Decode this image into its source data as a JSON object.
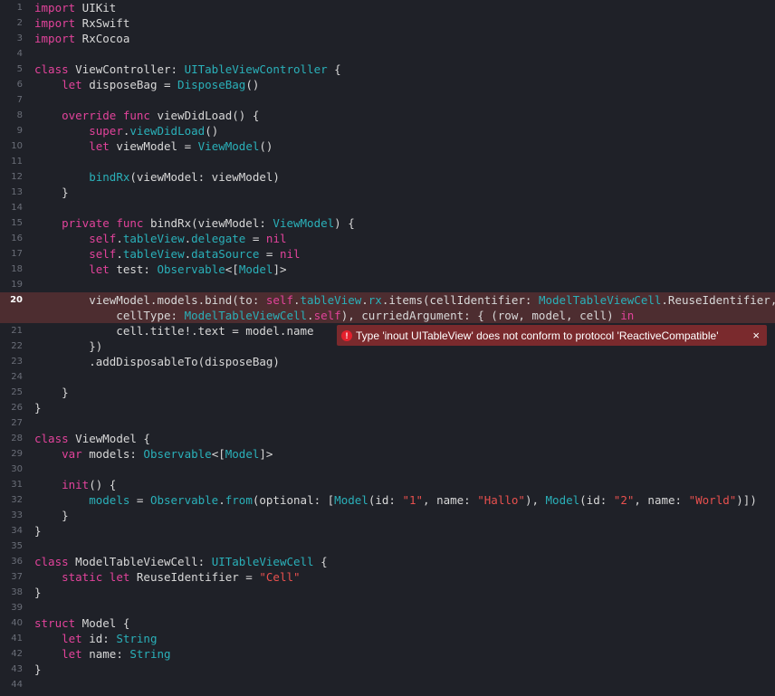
{
  "editor": {
    "colors": {
      "background": "#1f2128",
      "keyword": "#e2439b",
      "type": "#2ab0b9",
      "string": "#e8504e",
      "plain": "#d8d8d8",
      "error_line": "#4d2d30",
      "error_popup": "#7a2a2d"
    },
    "error": {
      "icon": "error-icon",
      "message": "Type 'inout UITableView' does not conform to protocol 'ReactiveCompatible'",
      "close": "×"
    },
    "lines": [
      {
        "n": "1",
        "segs": [
          [
            "kw",
            "import"
          ],
          [
            "plain",
            " UIKit"
          ]
        ]
      },
      {
        "n": "2",
        "segs": [
          [
            "kw",
            "import"
          ],
          [
            "plain",
            " RxSwift"
          ]
        ]
      },
      {
        "n": "3",
        "segs": [
          [
            "kw",
            "import"
          ],
          [
            "plain",
            " RxCocoa"
          ]
        ]
      },
      {
        "n": "4",
        "segs": []
      },
      {
        "n": "5",
        "segs": [
          [
            "kw",
            "class"
          ],
          [
            "plain",
            " ViewController: "
          ],
          [
            "type",
            "UITableViewController"
          ],
          [
            "plain",
            " {"
          ]
        ]
      },
      {
        "n": "6",
        "segs": [
          [
            "plain",
            "    "
          ],
          [
            "kw",
            "let"
          ],
          [
            "plain",
            " disposeBag = "
          ],
          [
            "type",
            "DisposeBag"
          ],
          [
            "plain",
            "()"
          ]
        ]
      },
      {
        "n": "7",
        "segs": []
      },
      {
        "n": "8",
        "segs": [
          [
            "plain",
            "    "
          ],
          [
            "kw",
            "override func"
          ],
          [
            "plain",
            " viewDidLoad() {"
          ]
        ]
      },
      {
        "n": "9",
        "segs": [
          [
            "plain",
            "        "
          ],
          [
            "kw",
            "super"
          ],
          [
            "plain",
            "."
          ],
          [
            "type",
            "viewDidLoad"
          ],
          [
            "plain",
            "()"
          ]
        ]
      },
      {
        "n": "10",
        "segs": [
          [
            "plain",
            "        "
          ],
          [
            "kw",
            "let"
          ],
          [
            "plain",
            " viewModel = "
          ],
          [
            "type",
            "ViewModel"
          ],
          [
            "plain",
            "()"
          ]
        ]
      },
      {
        "n": "11",
        "segs": []
      },
      {
        "n": "12",
        "segs": [
          [
            "plain",
            "        "
          ],
          [
            "type",
            "bindRx"
          ],
          [
            "plain",
            "(viewModel: viewModel)"
          ]
        ]
      },
      {
        "n": "13",
        "segs": [
          [
            "plain",
            "    }"
          ]
        ]
      },
      {
        "n": "14",
        "segs": []
      },
      {
        "n": "15",
        "segs": [
          [
            "plain",
            "    "
          ],
          [
            "kw",
            "private func"
          ],
          [
            "plain",
            " bindRx(viewModel: "
          ],
          [
            "type",
            "ViewModel"
          ],
          [
            "plain",
            ") {"
          ]
        ]
      },
      {
        "n": "16",
        "segs": [
          [
            "plain",
            "        "
          ],
          [
            "kw",
            "self"
          ],
          [
            "plain",
            "."
          ],
          [
            "type",
            "tableView"
          ],
          [
            "plain",
            "."
          ],
          [
            "type",
            "delegate"
          ],
          [
            "plain",
            " = "
          ],
          [
            "kw",
            "nil"
          ]
        ]
      },
      {
        "n": "17",
        "segs": [
          [
            "plain",
            "        "
          ],
          [
            "kw",
            "self"
          ],
          [
            "plain",
            "."
          ],
          [
            "type",
            "tableView"
          ],
          [
            "plain",
            "."
          ],
          [
            "type",
            "dataSource"
          ],
          [
            "plain",
            " = "
          ],
          [
            "kw",
            "nil"
          ]
        ]
      },
      {
        "n": "18",
        "segs": [
          [
            "plain",
            "        "
          ],
          [
            "kw",
            "let"
          ],
          [
            "plain",
            " test: "
          ],
          [
            "type",
            "Observable"
          ],
          [
            "plain",
            "<["
          ],
          [
            "type",
            "Model"
          ],
          [
            "plain",
            "]>"
          ]
        ]
      },
      {
        "n": "19",
        "segs": []
      },
      {
        "n": "20",
        "error": true,
        "segs": [
          [
            "plain",
            "        viewModel.models.bind(to: "
          ],
          [
            "kw",
            "self"
          ],
          [
            "plain",
            "."
          ],
          [
            "type",
            "tableView"
          ],
          [
            "plain",
            "."
          ],
          [
            "type",
            "rx"
          ],
          [
            "plain",
            ".items(cellIdentifier: "
          ],
          [
            "type",
            "ModelTableViewCell"
          ],
          [
            "plain",
            ".ReuseIdentifier,\n            cellType: "
          ],
          [
            "type",
            "ModelTableViewCell"
          ],
          [
            "plain",
            "."
          ],
          [
            "kw",
            "self"
          ],
          [
            "plain",
            "), curriedArgument: { (row, model, cell) "
          ],
          [
            "kw",
            "in"
          ]
        ]
      },
      {
        "n": "21",
        "segs": [
          [
            "plain",
            "            cell.title!.text = model.name"
          ]
        ]
      },
      {
        "n": "22",
        "segs": [
          [
            "plain",
            "        })"
          ]
        ]
      },
      {
        "n": "23",
        "segs": [
          [
            "plain",
            "        .addDisposableTo(disposeBag)"
          ]
        ]
      },
      {
        "n": "24",
        "segs": []
      },
      {
        "n": "25",
        "segs": [
          [
            "plain",
            "    }"
          ]
        ]
      },
      {
        "n": "26",
        "segs": [
          [
            "plain",
            "}"
          ]
        ]
      },
      {
        "n": "27",
        "segs": []
      },
      {
        "n": "28",
        "segs": [
          [
            "kw",
            "class"
          ],
          [
            "plain",
            " ViewModel {"
          ]
        ]
      },
      {
        "n": "29",
        "segs": [
          [
            "plain",
            "    "
          ],
          [
            "kw",
            "var"
          ],
          [
            "plain",
            " models: "
          ],
          [
            "type",
            "Observable"
          ],
          [
            "plain",
            "<["
          ],
          [
            "type",
            "Model"
          ],
          [
            "plain",
            "]>"
          ]
        ]
      },
      {
        "n": "30",
        "segs": []
      },
      {
        "n": "31",
        "segs": [
          [
            "plain",
            "    "
          ],
          [
            "kw",
            "init"
          ],
          [
            "plain",
            "() {"
          ]
        ]
      },
      {
        "n": "32",
        "segs": [
          [
            "plain",
            "        "
          ],
          [
            "type",
            "models"
          ],
          [
            "plain",
            " = "
          ],
          [
            "type",
            "Observable"
          ],
          [
            "plain",
            "."
          ],
          [
            "type",
            "from"
          ],
          [
            "plain",
            "(optional: ["
          ],
          [
            "type",
            "Model"
          ],
          [
            "plain",
            "(id: "
          ],
          [
            "str",
            "\"1\""
          ],
          [
            "plain",
            ", name: "
          ],
          [
            "str",
            "\"Hallo\""
          ],
          [
            "plain",
            "), "
          ],
          [
            "type",
            "Model"
          ],
          [
            "plain",
            "(id: "
          ],
          [
            "str",
            "\"2\""
          ],
          [
            "plain",
            ", name: "
          ],
          [
            "str",
            "\"World\""
          ],
          [
            "plain",
            ")])"
          ]
        ]
      },
      {
        "n": "33",
        "segs": [
          [
            "plain",
            "    }"
          ]
        ]
      },
      {
        "n": "34",
        "segs": [
          [
            "plain",
            "}"
          ]
        ]
      },
      {
        "n": "35",
        "segs": []
      },
      {
        "n": "36",
        "segs": [
          [
            "kw",
            "class"
          ],
          [
            "plain",
            " ModelTableViewCell: "
          ],
          [
            "type",
            "UITableViewCell"
          ],
          [
            "plain",
            " {"
          ]
        ]
      },
      {
        "n": "37",
        "segs": [
          [
            "plain",
            "    "
          ],
          [
            "kw",
            "static let"
          ],
          [
            "plain",
            " ReuseIdentifier = "
          ],
          [
            "str",
            "\"Cell\""
          ]
        ]
      },
      {
        "n": "38",
        "segs": [
          [
            "plain",
            "}"
          ]
        ]
      },
      {
        "n": "39",
        "segs": []
      },
      {
        "n": "40",
        "segs": [
          [
            "kw",
            "struct"
          ],
          [
            "plain",
            " Model {"
          ]
        ]
      },
      {
        "n": "41",
        "segs": [
          [
            "plain",
            "    "
          ],
          [
            "kw",
            "let"
          ],
          [
            "plain",
            " id: "
          ],
          [
            "type",
            "String"
          ]
        ]
      },
      {
        "n": "42",
        "segs": [
          [
            "plain",
            "    "
          ],
          [
            "kw",
            "let"
          ],
          [
            "plain",
            " name: "
          ],
          [
            "type",
            "String"
          ]
        ]
      },
      {
        "n": "43",
        "segs": [
          [
            "plain",
            "}"
          ]
        ]
      },
      {
        "n": "44",
        "segs": []
      }
    ]
  }
}
